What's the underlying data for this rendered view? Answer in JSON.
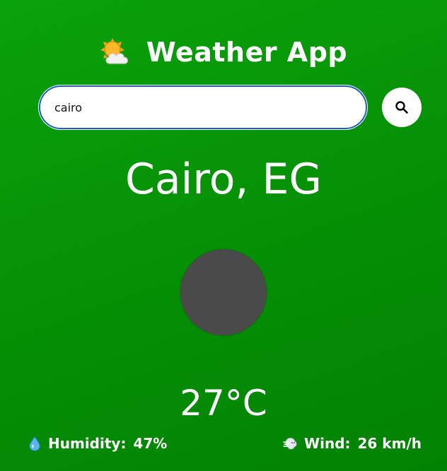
{
  "app": {
    "title": "Weather App",
    "header_icon": "sun-behind-cloud-icon"
  },
  "search": {
    "value": "cairo",
    "placeholder": "",
    "button_icon": "search-icon"
  },
  "weather": {
    "location": "Cairo, EG",
    "icon": "weather-condition-icon",
    "temperature": "27°C"
  },
  "stats": {
    "humidity": {
      "icon": "droplet-icon",
      "label": "Humidity:",
      "value": "47%"
    },
    "wind": {
      "icon": "wind-face-icon",
      "label": "Wind:",
      "value": "26 km/h"
    }
  },
  "colors": {
    "background_top": "#0aa20a",
    "background_bottom": "#028202",
    "text": "#ffffff",
    "input_border": "#1f5fbf",
    "weather_icon_fill": "#4a4a4a"
  }
}
